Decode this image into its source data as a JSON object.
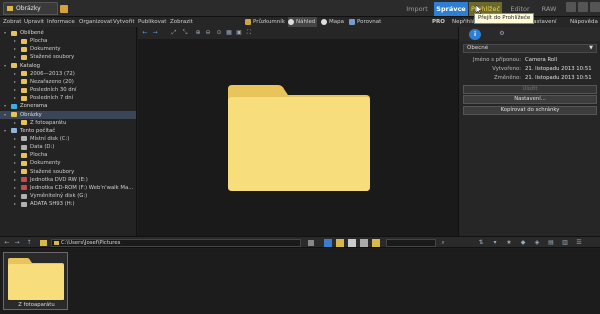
{
  "window": {
    "tab_title": "Obrázky"
  },
  "modes": [
    {
      "label": "Import",
      "active": false
    },
    {
      "label": "Správce",
      "active": true
    },
    {
      "label": "Prohlížeč",
      "active": false
    },
    {
      "label": "Editor",
      "active": false
    },
    {
      "label": "RAW",
      "active": false
    }
  ],
  "tooltip": "Přejít do Prohlížeče",
  "menu": [
    "Zobrat",
    "Upravit",
    "Informace",
    "Organizovat",
    "Vytvořit",
    "Publikovat",
    "Zobrazit"
  ],
  "view_buttons": [
    "Průzkumník",
    "Náhled",
    "Mapa",
    "Porovnat"
  ],
  "right_menu": [
    "PRO",
    "Nepřihlášeno",
    "Nastavení",
    "Nápověda"
  ],
  "tree": [
    {
      "label": "Oblíbené",
      "indent": 0,
      "section": true,
      "icon": "star-folder-icon"
    },
    {
      "label": "Plocha",
      "indent": 1,
      "icon": "folder-icon"
    },
    {
      "label": "Dokumenty",
      "indent": 1,
      "icon": "folder-icon"
    },
    {
      "label": "Stažené soubory",
      "indent": 1,
      "icon": "folder-icon"
    },
    {
      "label": "Katalog",
      "indent": 0,
      "section": true,
      "icon": "catalog-icon"
    },
    {
      "label": "2006—2013 (72)",
      "indent": 1,
      "icon": "folder-icon"
    },
    {
      "label": "Nezařazeno (20)",
      "indent": 1,
      "icon": "folder-icon"
    },
    {
      "label": "Posledních 30 dní",
      "indent": 1,
      "icon": "folder-icon"
    },
    {
      "label": "Posledních 7 dní",
      "indent": 1,
      "icon": "folder-icon"
    },
    {
      "label": "Zonerama",
      "indent": 0,
      "section": true,
      "icon": "zonerama-icon"
    },
    {
      "label": "Obrázky",
      "indent": 0,
      "section": true,
      "icon": "folder-icon",
      "selected": true
    },
    {
      "label": "Z fotoaparátu",
      "indent": 1,
      "icon": "folder-icon"
    },
    {
      "label": "Tento počítač",
      "indent": 0,
      "section": true,
      "icon": "computer-icon"
    },
    {
      "label": "Místní disk (C:)",
      "indent": 1,
      "icon": "drive-icon"
    },
    {
      "label": "Data (D:)",
      "indent": 1,
      "icon": "drive-icon"
    },
    {
      "label": "Plocha",
      "indent": 1,
      "icon": "folder-icon"
    },
    {
      "label": "Dokumenty",
      "indent": 1,
      "icon": "folder-icon"
    },
    {
      "label": "Stažené soubory",
      "indent": 1,
      "icon": "folder-icon"
    },
    {
      "label": "Jednotka DVD RW (E:)",
      "indent": 1,
      "icon": "dvd-icon"
    },
    {
      "label": "Jednotka CD-ROM (F:) Web'n'walk Ma...",
      "indent": 1,
      "icon": "cd-icon"
    },
    {
      "label": "Vyměnitelný disk (G:)",
      "indent": 1,
      "icon": "drive-icon"
    },
    {
      "label": "ADATA SH93 (H:)",
      "indent": 1,
      "icon": "drive-icon"
    }
  ],
  "info_panel": {
    "section": "Obecné",
    "rows": [
      {
        "key": "Jméno s příponou:",
        "value": "Camera Roll"
      },
      {
        "key": "Vytvořeno:",
        "value": "21. listopadu 2013 10:51"
      },
      {
        "key": "Změněno:",
        "value": "21. listopadu 2013 10:51"
      }
    ],
    "buttons": [
      {
        "label": "Uložit",
        "enabled": false
      },
      {
        "label": "Nastavení...",
        "enabled": true
      },
      {
        "label": "Kopírovat do schránky",
        "enabled": true
      }
    ]
  },
  "path": "C:\\Users\\Josef\\Pictures",
  "thumbnail": {
    "label": "Z fotoaparátu"
  },
  "colors": {
    "accent": "#2c7fd4",
    "folder": "#f6d774",
    "selected_row": "#3a4658"
  }
}
